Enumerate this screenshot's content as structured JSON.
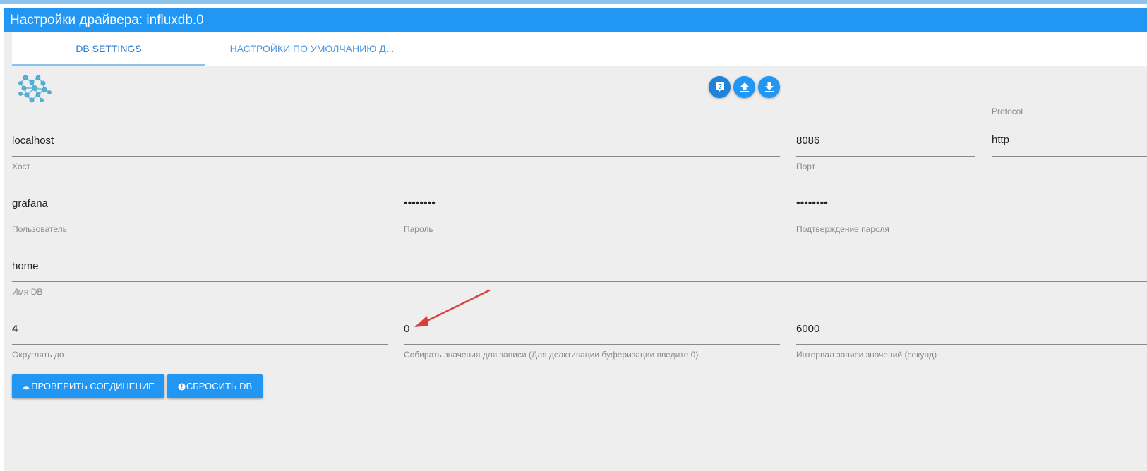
{
  "window": {
    "title": "Настройки драйвера: influxdb.0"
  },
  "tabs": [
    {
      "label": "DB SETTINGS",
      "active": true
    },
    {
      "label": "НАСТРОЙКИ ПО УМОЛЧАНИЮ Д...",
      "active": false
    }
  ],
  "toolbar": {
    "help_icon": "help-question-icon",
    "upload_icon": "upload-icon",
    "download_icon": "download-icon"
  },
  "fields": {
    "host": {
      "value": "localhost",
      "label": "Хост"
    },
    "port": {
      "value": "8086",
      "label": "Порт"
    },
    "protocol": {
      "value": "http",
      "label": "Protocol"
    },
    "user": {
      "value": "grafana",
      "label": "Пользователь"
    },
    "password": {
      "value": "••••••••",
      "label": "Пароль"
    },
    "password_confirm": {
      "value": "••••••••",
      "label": "Подтверждение пароля"
    },
    "dbname": {
      "value": "home",
      "label": "Имя DB"
    },
    "round": {
      "value": "4",
      "label": "Округлять до"
    },
    "seriesBufferMax": {
      "value": "0",
      "label": "Собирать значения для записи (Для деактивации буферизации введите 0)"
    },
    "seriesBufferFlushInterval": {
      "value": "6000",
      "label": "Интервал записи значений (секунд)"
    }
  },
  "buttons": {
    "test_connection": "ПРОВЕРИТЬ СОЕДИНЕНИЕ",
    "reset_db": "СБРОСИТЬ DB"
  },
  "colors": {
    "primary": "#2196f3",
    "annotation_arrow": "#d9403a"
  }
}
